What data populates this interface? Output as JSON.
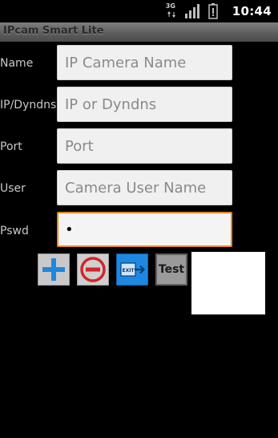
{
  "status_bar": {
    "network_type": "3G",
    "time": "10:44",
    "icons": [
      "network-3g-icon",
      "signal-icon",
      "battery-icon"
    ]
  },
  "app": {
    "title": "IPcam Smart Lite"
  },
  "form": {
    "name": {
      "label": "Name",
      "placeholder": "IP Camera Name",
      "value": ""
    },
    "ip": {
      "label": "IP/Dyndns",
      "placeholder": "IP or Dyndns",
      "value": ""
    },
    "port": {
      "label": "Port",
      "placeholder": "Port",
      "value": ""
    },
    "user": {
      "label": "User",
      "placeholder": "Camera User Name",
      "value": ""
    },
    "pswd": {
      "label": "Pswd",
      "placeholder": "",
      "value": "•"
    }
  },
  "toolbar": {
    "add_icon": "plus-icon",
    "remove_icon": "minus-circle-icon",
    "exit_icon": "exit-icon",
    "exit_text": "EXIT",
    "test_label": "Test"
  },
  "colors": {
    "accent_focus": "#e8891a",
    "add_blue": "#1e88e0",
    "remove_red": "#d2252a",
    "exit_blue": "#1e88e0"
  }
}
